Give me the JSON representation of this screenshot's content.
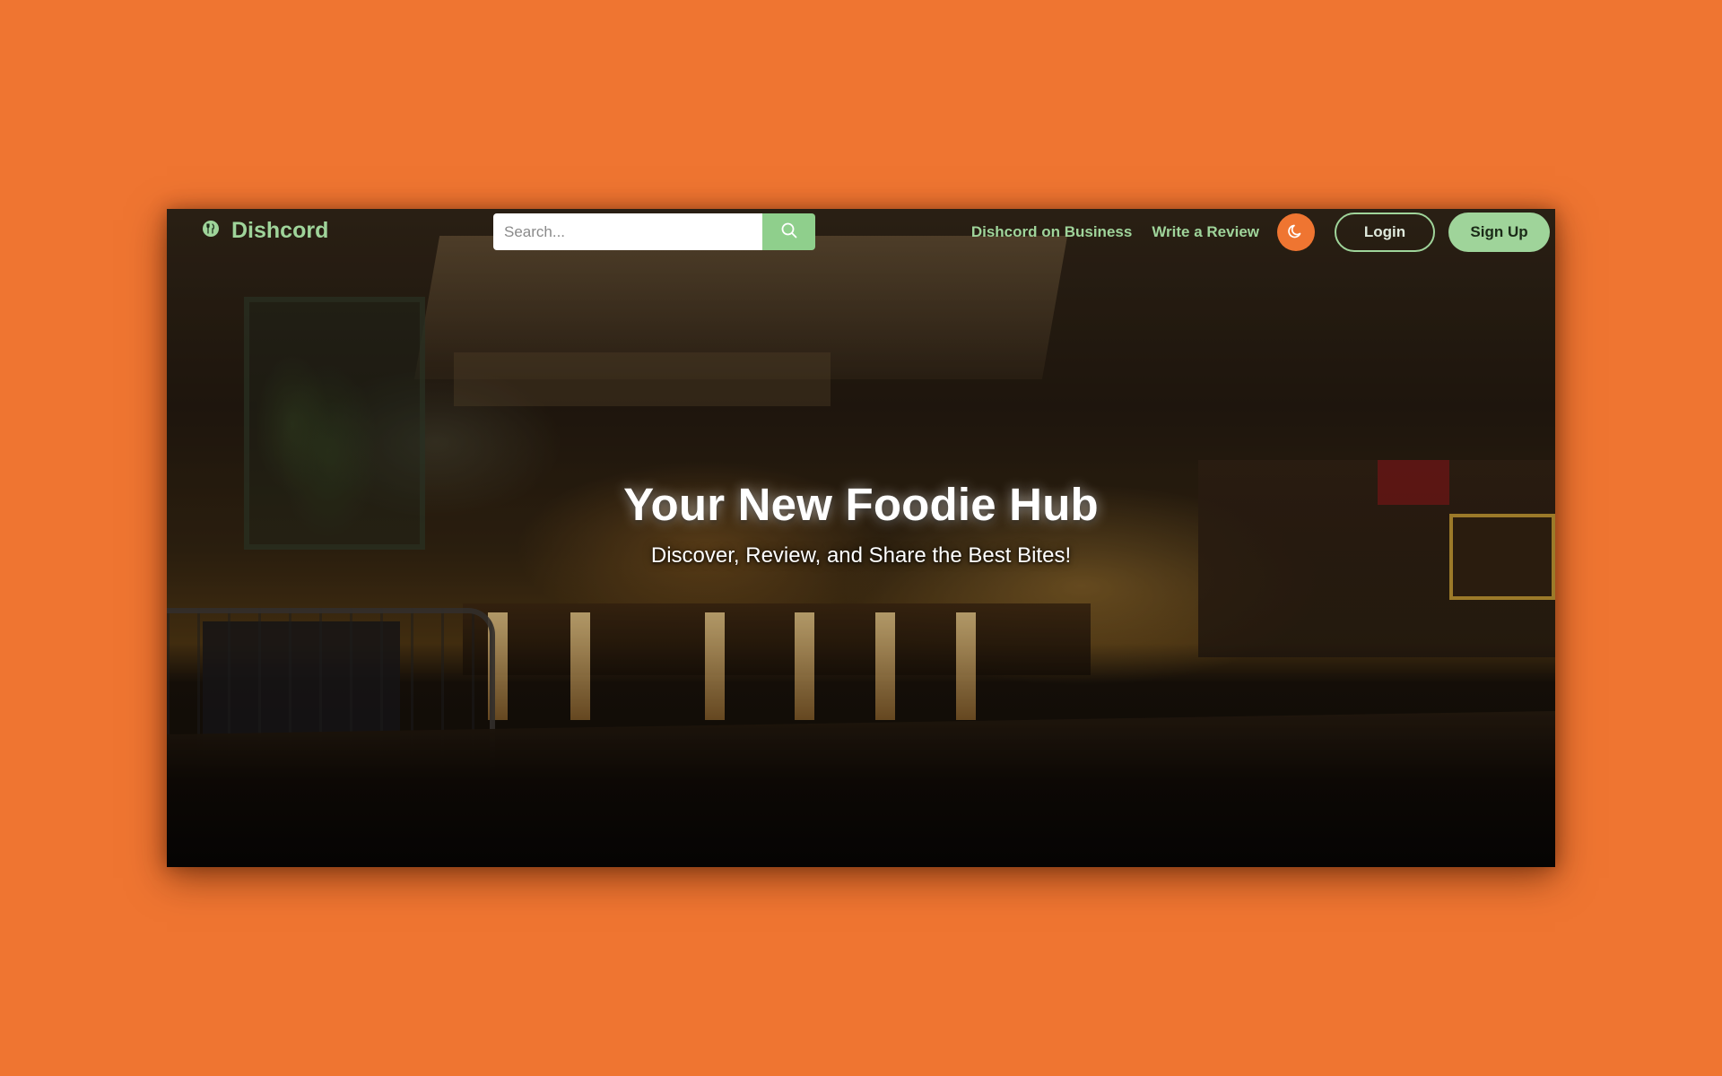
{
  "brand": {
    "name": "Dishcord",
    "icon": "utensils-icon",
    "color": "#9fd49a"
  },
  "search": {
    "placeholder": "Search...",
    "value": "",
    "button_icon": "search-icon",
    "button_color": "#8fcf8c"
  },
  "nav": {
    "business_link": "Dishcord on Business",
    "review_link": "Write a Review",
    "theme_toggle_icon": "moon-icon",
    "theme_toggle_color": "#ef7531",
    "login_label": "Login",
    "signup_label": "Sign Up"
  },
  "hero": {
    "title": "Your New Foodie Hub",
    "subtitle": "Discover, Review, and Share the Best Bites!",
    "background_image": "restaurant-bar-interior"
  },
  "colors": {
    "page_background": "#ef7531",
    "accent_green": "#9fd49a"
  }
}
